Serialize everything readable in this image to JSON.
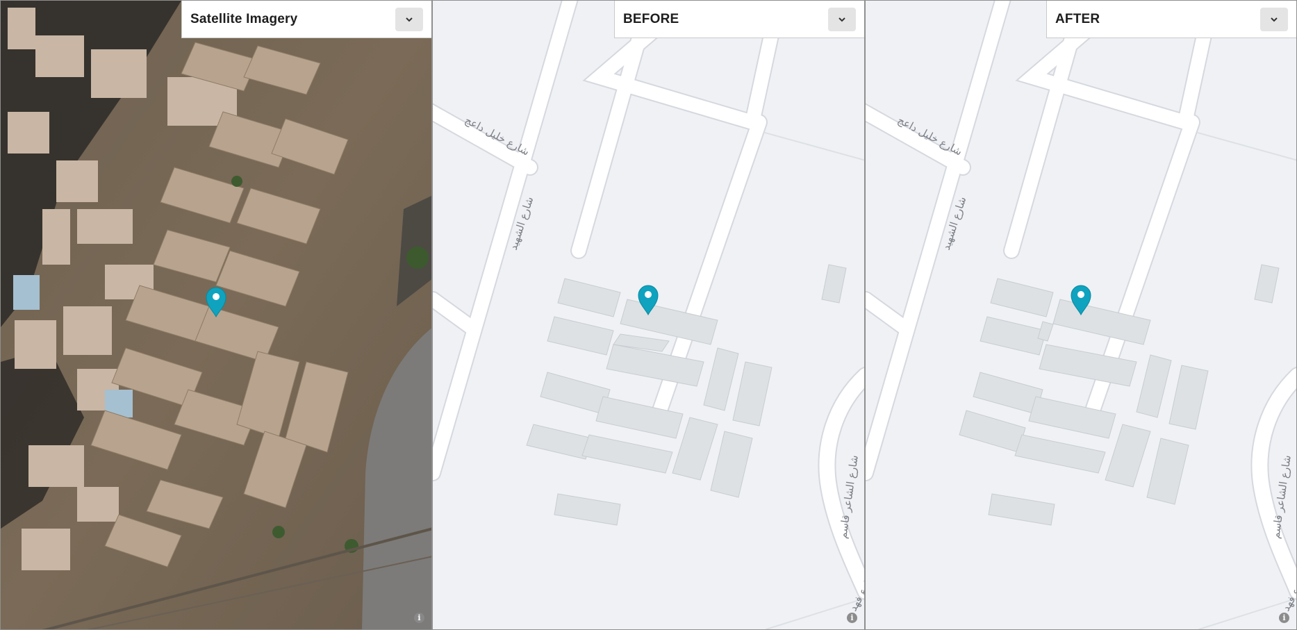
{
  "panels": [
    {
      "id": "satellite",
      "title": "Satellite Imagery",
      "dropdown_icon": "chevron-down-icon",
      "marker_icon": "map-pin-icon",
      "info_icon_label": "i"
    },
    {
      "id": "before",
      "title": "BEFORE",
      "dropdown_icon": "chevron-down-icon",
      "marker_icon": "map-pin-icon",
      "info_icon_label": "i"
    },
    {
      "id": "after",
      "title": "AFTER",
      "dropdown_icon": "chevron-down-icon",
      "marker_icon": "map-pin-icon",
      "info_icon_label": "i"
    }
  ],
  "street_labels": {
    "diagonal_street": "شارع خليل داعج",
    "vertical_street": "شارع الشهيد",
    "curved_street_1": "شارع الشاعر قاسم",
    "curved_street_2": "شارع فهد"
  },
  "colors": {
    "marker": "#0fa3bf",
    "road": "#ffffff",
    "road_casing": "#d5d8de",
    "land": "#eff1f5",
    "building": "#dde1e4",
    "building_stroke": "#c8ccd0"
  }
}
